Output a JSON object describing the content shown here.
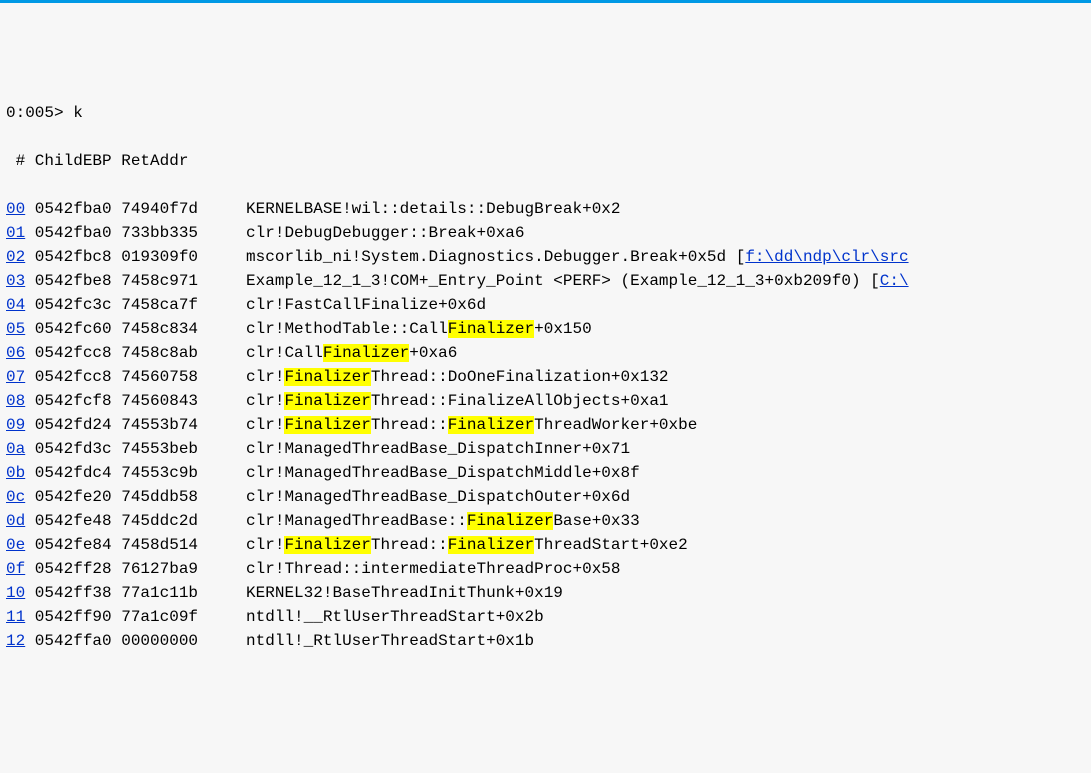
{
  "prompt": "0:005> k",
  "header": " # ChildEBP RetAddr  ",
  "rows": [
    {
      "idx": "00",
      "childebp": "0542fba0",
      "retaddr": "74940f7d",
      "segments": [
        {
          "t": "plain",
          "v": "KERNELBASE!wil::details::DebugBreak+0x2"
        }
      ]
    },
    {
      "idx": "01",
      "childebp": "0542fba0",
      "retaddr": "733bb335",
      "segments": [
        {
          "t": "plain",
          "v": "clr!DebugDebugger::Break+0xa6"
        }
      ]
    },
    {
      "idx": "02",
      "childebp": "0542fbc8",
      "retaddr": "019309f0",
      "segments": [
        {
          "t": "plain",
          "v": "mscorlib_ni!System.Diagnostics.Debugger.Break+0x5d ["
        },
        {
          "t": "link",
          "v": "f:\\dd\\ndp\\clr\\src"
        }
      ]
    },
    {
      "idx": "03",
      "childebp": "0542fbe8",
      "retaddr": "7458c971",
      "segments": [
        {
          "t": "plain",
          "v": "Example_12_1_3!COM+_Entry_Point <PERF> (Example_12_1_3+0xb209f0) ["
        },
        {
          "t": "link",
          "v": "C:\\"
        }
      ]
    },
    {
      "idx": "04",
      "childebp": "0542fc3c",
      "retaddr": "7458ca7f",
      "segments": [
        {
          "t": "plain",
          "v": "clr!FastCallFinalize+0x6d"
        }
      ]
    },
    {
      "idx": "05",
      "childebp": "0542fc60",
      "retaddr": "7458c834",
      "segments": [
        {
          "t": "plain",
          "v": "clr!MethodTable::Call"
        },
        {
          "t": "hl",
          "v": "Finalizer"
        },
        {
          "t": "plain",
          "v": "+0x150"
        }
      ]
    },
    {
      "idx": "06",
      "childebp": "0542fcc8",
      "retaddr": "7458c8ab",
      "segments": [
        {
          "t": "plain",
          "v": "clr!Call"
        },
        {
          "t": "hl",
          "v": "Finalizer"
        },
        {
          "t": "plain",
          "v": "+0xa6"
        }
      ]
    },
    {
      "idx": "07",
      "childebp": "0542fcc8",
      "retaddr": "74560758",
      "segments": [
        {
          "t": "plain",
          "v": "clr!"
        },
        {
          "t": "hl",
          "v": "Finalizer"
        },
        {
          "t": "plain",
          "v": "Thread::DoOneFinalization+0x132"
        }
      ]
    },
    {
      "idx": "08",
      "childebp": "0542fcf8",
      "retaddr": "74560843",
      "segments": [
        {
          "t": "plain",
          "v": "clr!"
        },
        {
          "t": "hl",
          "v": "Finalizer"
        },
        {
          "t": "plain",
          "v": "Thread::FinalizeAllObjects+0xa1"
        }
      ]
    },
    {
      "idx": "09",
      "childebp": "0542fd24",
      "retaddr": "74553b74",
      "segments": [
        {
          "t": "plain",
          "v": "clr!"
        },
        {
          "t": "hl",
          "v": "Finalizer"
        },
        {
          "t": "plain",
          "v": "Thread::"
        },
        {
          "t": "hl",
          "v": "Finalizer"
        },
        {
          "t": "plain",
          "v": "ThreadWorker+0xbe"
        }
      ]
    },
    {
      "idx": "0a",
      "childebp": "0542fd3c",
      "retaddr": "74553beb",
      "segments": [
        {
          "t": "plain",
          "v": "clr!ManagedThreadBase_DispatchInner+0x71"
        }
      ]
    },
    {
      "idx": "0b",
      "childebp": "0542fdc4",
      "retaddr": "74553c9b",
      "segments": [
        {
          "t": "plain",
          "v": "clr!ManagedThreadBase_DispatchMiddle+0x8f"
        }
      ]
    },
    {
      "idx": "0c",
      "childebp": "0542fe20",
      "retaddr": "745ddb58",
      "segments": [
        {
          "t": "plain",
          "v": "clr!ManagedThreadBase_DispatchOuter+0x6d"
        }
      ]
    },
    {
      "idx": "0d",
      "childebp": "0542fe48",
      "retaddr": "745ddc2d",
      "segments": [
        {
          "t": "plain",
          "v": "clr!ManagedThreadBase::"
        },
        {
          "t": "hl",
          "v": "Finalizer"
        },
        {
          "t": "plain",
          "v": "Base+0x33"
        }
      ]
    },
    {
      "idx": "0e",
      "childebp": "0542fe84",
      "retaddr": "7458d514",
      "segments": [
        {
          "t": "plain",
          "v": "clr!"
        },
        {
          "t": "hl",
          "v": "Finalizer"
        },
        {
          "t": "plain",
          "v": "Thread::"
        },
        {
          "t": "hl",
          "v": "Finalizer"
        },
        {
          "t": "plain",
          "v": "ThreadStart+0xe2"
        }
      ]
    },
    {
      "idx": "0f",
      "childebp": "0542ff28",
      "retaddr": "76127ba9",
      "segments": [
        {
          "t": "plain",
          "v": "clr!Thread::intermediateThreadProc+0x58"
        }
      ]
    },
    {
      "idx": "10",
      "childebp": "0542ff38",
      "retaddr": "77a1c11b",
      "segments": [
        {
          "t": "plain",
          "v": "KERNEL32!BaseThreadInitThunk+0x19"
        }
      ]
    },
    {
      "idx": "11",
      "childebp": "0542ff90",
      "retaddr": "77a1c09f",
      "segments": [
        {
          "t": "plain",
          "v": "ntdll!__RtlUserThreadStart+0x2b"
        }
      ]
    },
    {
      "idx": "12",
      "childebp": "0542ffa0",
      "retaddr": "00000000",
      "segments": [
        {
          "t": "plain",
          "v": "ntdll!_RtlUserThreadStart+0x1b"
        }
      ]
    }
  ]
}
